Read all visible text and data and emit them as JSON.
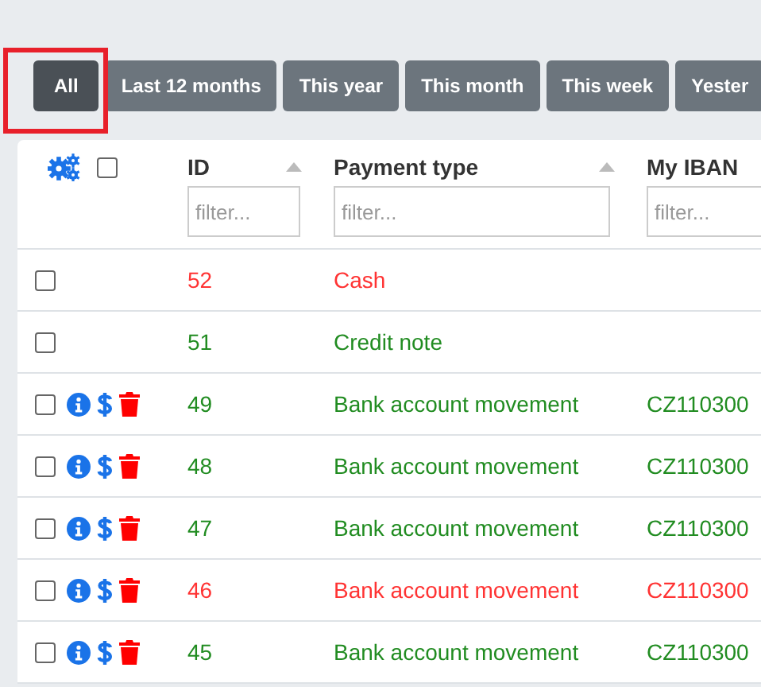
{
  "filters": [
    {
      "label": "All",
      "selected": true
    },
    {
      "label": "Last 12 months",
      "selected": false
    },
    {
      "label": "This year",
      "selected": false
    },
    {
      "label": "This month",
      "selected": false
    },
    {
      "label": "This week",
      "selected": false
    },
    {
      "label": "Yester",
      "selected": false
    }
  ],
  "table": {
    "select_all_checked": false,
    "columns": [
      {
        "label": "ID",
        "placeholder": "filter...",
        "sortable": true
      },
      {
        "label": "Payment type",
        "placeholder": "filter...",
        "sortable": true
      },
      {
        "label": "My IBAN",
        "placeholder": "filter...",
        "sortable": false
      }
    ],
    "rows": [
      {
        "checked": false,
        "actions": false,
        "color": "#ff3333",
        "id": "52",
        "payment_type": "Cash"
      },
      {
        "checked": false,
        "actions": false,
        "color": "#218c21",
        "id": "51",
        "payment_type": "Credit note"
      },
      {
        "checked": false,
        "actions": true,
        "color": "#218c21",
        "id": "49",
        "payment_type": "Bank account movement",
        "my_iban": "CZ110300"
      },
      {
        "checked": false,
        "actions": true,
        "color": "#218c21",
        "id": "48",
        "payment_type": "Bank account movement",
        "my_iban": "CZ110300"
      },
      {
        "checked": false,
        "actions": true,
        "color": "#218c21",
        "id": "47",
        "payment_type": "Bank account movement",
        "my_iban": "CZ110300"
      },
      {
        "checked": false,
        "actions": true,
        "color": "#ff3333",
        "id": "46",
        "payment_type": "Bank account movement",
        "my_iban": "CZ110300"
      },
      {
        "checked": false,
        "actions": true,
        "color": "#218c21",
        "id": "45",
        "payment_type": "Bank account movement",
        "my_iban": "CZ110300"
      }
    ]
  }
}
